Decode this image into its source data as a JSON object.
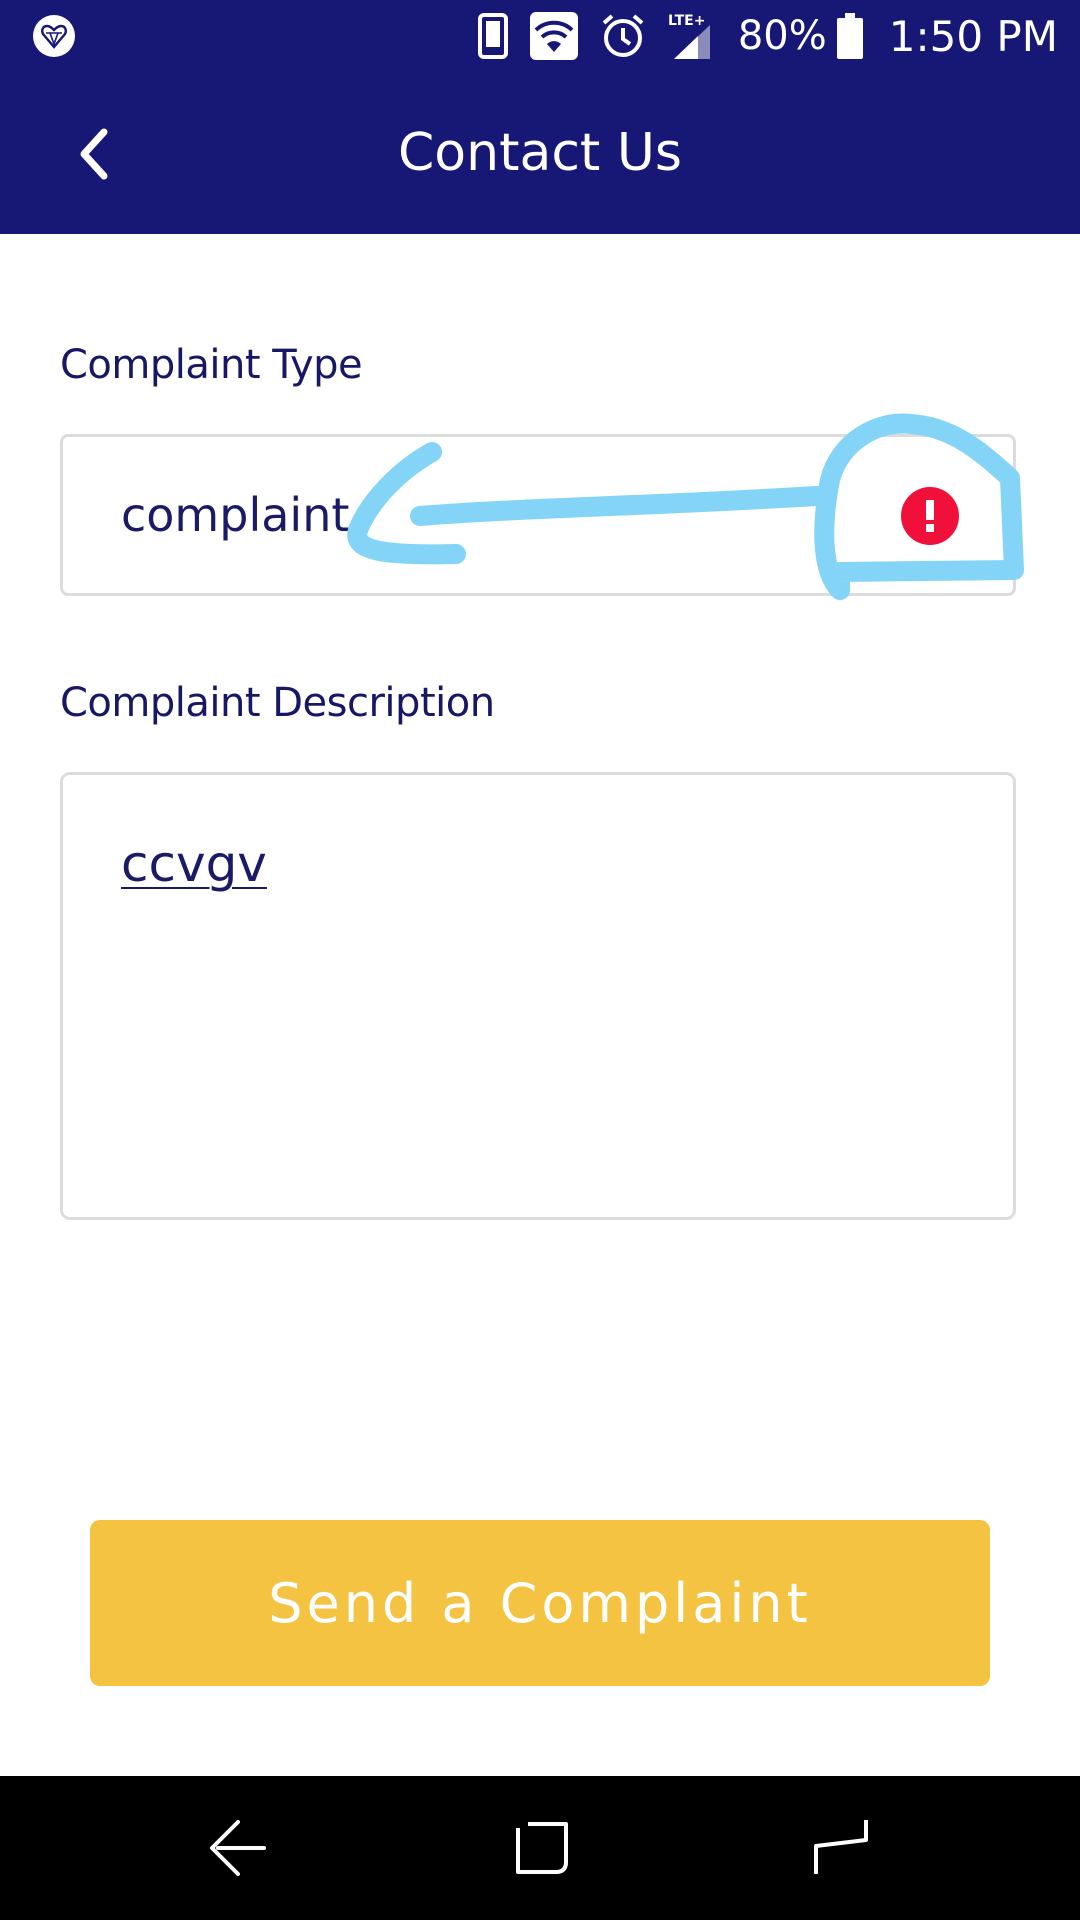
{
  "status_bar": {
    "battery_percent": "80%",
    "time": "1:50 PM",
    "network_label": "LTE+",
    "icons": [
      "app-logo-icon",
      "phone-icon",
      "wifi-icon",
      "alarm-icon",
      "signal-icon",
      "battery-icon"
    ]
  },
  "app_bar": {
    "title": "Contact Us",
    "back_icon": "chevron-left-icon"
  },
  "form": {
    "complaint_type": {
      "label": "Complaint Type",
      "value": "complaint",
      "error_icon": "error-alert-icon"
    },
    "complaint_description": {
      "label": "Complaint Description",
      "value": "ccvgv"
    },
    "submit_label": "Send a Complaint"
  },
  "nav_bar": {
    "icons": [
      "back-nav-icon",
      "home-nav-icon",
      "recents-nav-icon"
    ]
  },
  "colors": {
    "primary": "#171775",
    "accent": "#f5c342",
    "error": "#f0103a",
    "annotation": "#84d4f8"
  }
}
